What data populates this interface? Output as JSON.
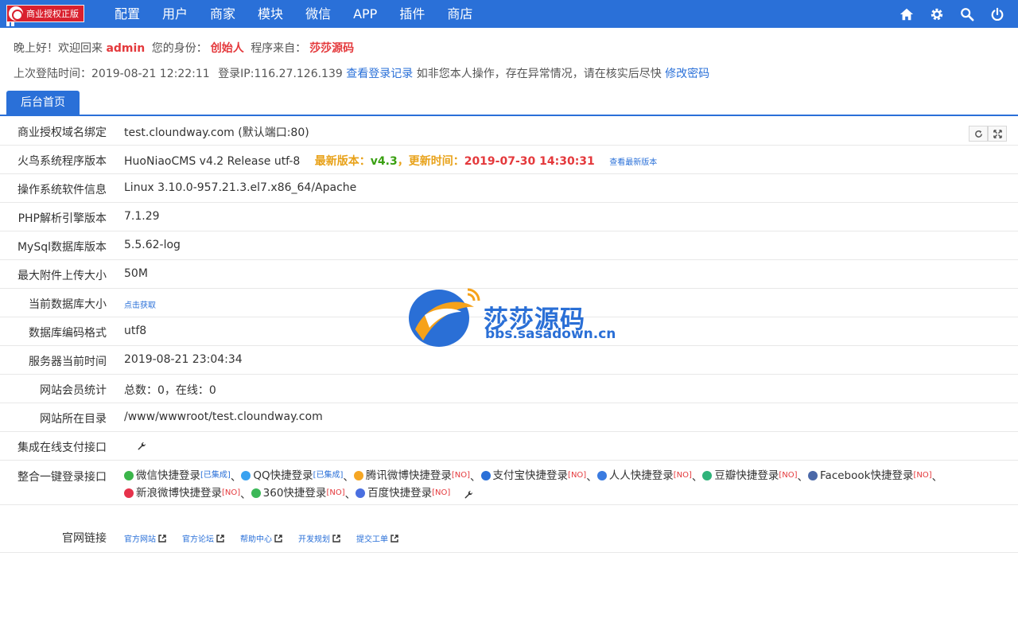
{
  "brand": {
    "label": "商业授权正版"
  },
  "nav": {
    "items": [
      "配置",
      "用户",
      "商家",
      "模块",
      "微信",
      "APP",
      "插件",
      "商店"
    ]
  },
  "top_icons": [
    "home-icon",
    "gear-icon",
    "search-icon",
    "power-icon"
  ],
  "welcome": {
    "greeting": "晚上好！欢迎回来",
    "username": "admin",
    "identity_label": "您的身份：",
    "identity": "创始人",
    "source_label": "程序来自：",
    "source": "莎莎源码"
  },
  "lastlogin": {
    "time_label": "上次登陆时间：",
    "time": "2019-08-21 12:22:11",
    "ip_label": "登录IP:",
    "ip": "116.27.126.139",
    "view_log": "查看登录记录",
    "notice": "如非您本人操作，存在异常情况，请在核实后尽快",
    "change_password": "修改密码"
  },
  "tab": {
    "label": "后台首页"
  },
  "rows": {
    "domain": {
      "label": "商业授权域名绑定",
      "value": "test.cloundway.com (默认端口:80)"
    },
    "version": {
      "label": "火鸟系统程序版本",
      "value": "HuoNiaoCMS v4.2 Release utf-8",
      "latest_label": "最新版本：",
      "latest": "v4.3",
      "update_label": "，更新时间：",
      "update_time": "2019-07-30 14:30:31",
      "check_link": "查看最新版本"
    },
    "os": {
      "label": "操作系统软件信息",
      "value": "Linux 3.10.0-957.21.3.el7.x86_64/Apache"
    },
    "php": {
      "label": "PHP解析引擎版本",
      "value": "7.1.29"
    },
    "mysql": {
      "label": "MySql数据库版本",
      "value": "5.5.62-log"
    },
    "upload": {
      "label": "最大附件上传大小",
      "value": "50M"
    },
    "dbsize": {
      "label": "当前数据库大小",
      "link": "点击获取"
    },
    "charset": {
      "label": "数据库编码格式",
      "value": "utf8"
    },
    "servertime": {
      "label": "服务器当前时间",
      "value": "2019-08-21 23:04:34"
    },
    "members": {
      "label": "网站会员统计",
      "value": "总数：0，在线：0"
    },
    "dir": {
      "label": "网站所在目录",
      "value": "/www/wwwroot/test.cloundway.com"
    },
    "payment": {
      "label": "集成在线支付接口"
    },
    "login": {
      "label": "整合一键登录接口",
      "sep": "、",
      "items": [
        {
          "name": "微信快捷登录",
          "tag": "[已集成]",
          "color": "#3bb54a"
        },
        {
          "name": "QQ快捷登录",
          "tag": "[已集成]",
          "color": "#3aa2f0"
        },
        {
          "name": "腾讯微博快捷登录",
          "tag": "[NO]",
          "color": "#f5a623"
        },
        {
          "name": "支付宝快捷登录",
          "tag": "[NO]",
          "color": "#2a70d8"
        },
        {
          "name": "人人快捷登录",
          "tag": "[NO]",
          "color": "#3a7be0"
        },
        {
          "name": "豆瓣快捷登录",
          "tag": "[NO]",
          "color": "#2fb37a"
        },
        {
          "name": "Facebook快捷登录",
          "tag": "[NO]",
          "color": "#4a68a8"
        },
        {
          "name": "新浪微博快捷登录",
          "tag": "[NO]",
          "color": "#e6324b"
        },
        {
          "name": "360快捷登录",
          "tag": "[NO]",
          "color": "#3cb858"
        },
        {
          "name": "百度快捷登录",
          "tag": "[NO]",
          "color": "#4a6fe0"
        }
      ]
    },
    "links": {
      "label": "官网链接",
      "items": [
        "官方网站",
        "官方论坛",
        "帮助中心",
        "开发规划",
        "提交工单"
      ]
    }
  },
  "watermark": {
    "title": "莎莎源码",
    "url": "bbs.sasadown.cn"
  },
  "colors": {
    "primary": "#2a70d8",
    "accent_red": "#e4393c",
    "green": "#3aa012",
    "orange": "#e8a21a"
  }
}
